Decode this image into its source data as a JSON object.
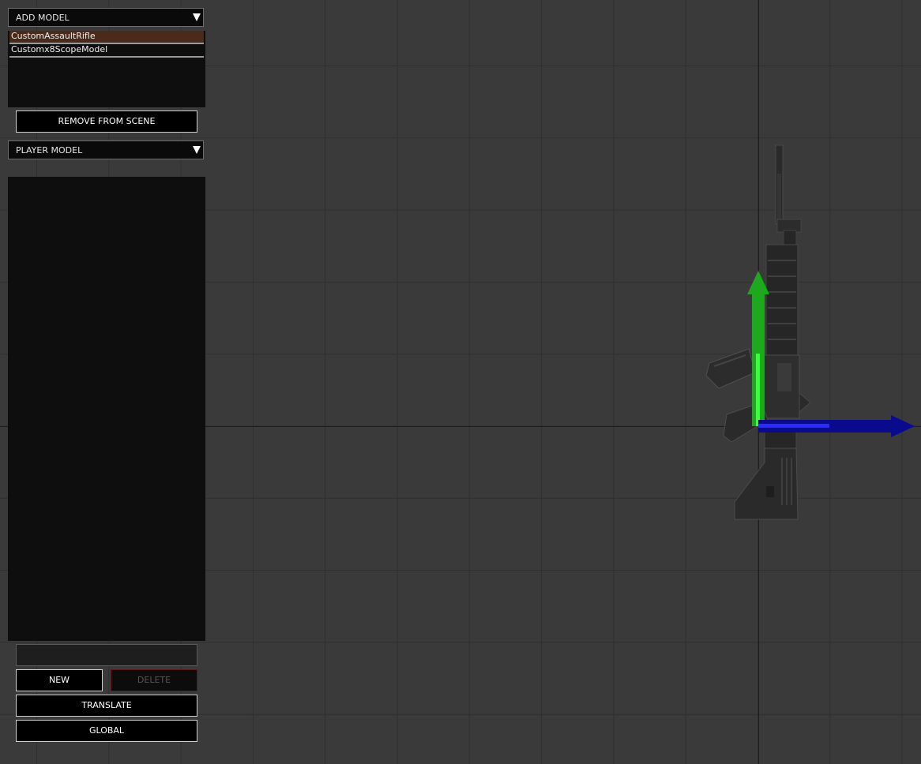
{
  "top_dropdown": {
    "label": "ADD MODEL"
  },
  "model_list": {
    "items": [
      {
        "label": "CustomAssaultRifle",
        "selected": true
      },
      {
        "label": "Customx8ScopeModel",
        "selected": false
      }
    ]
  },
  "remove_button": {
    "label": "REMOVE FROM SCENE"
  },
  "second_dropdown": {
    "label": "PLAYER MODEL"
  },
  "name_input": {
    "value": "",
    "placeholder": ""
  },
  "buttons": {
    "new": "NEW",
    "delete": "DELETE",
    "translate": "TRANSLATE",
    "global": "GLOBAL"
  },
  "colors": {
    "viewport_bg": "#3a3a3a",
    "grid_line": "#2f2f2f",
    "gizmo_y": "#1ea81e",
    "gizmo_y_highlight": "#3cff3c",
    "gizmo_x": "#0a0a8c",
    "gizmo_x_highlight": "#2a2aff",
    "selected_item_bg": "#4a2a1a"
  },
  "icons": {
    "dropdown_arrow": "triangle-down-icon",
    "gizmo_up": "arrow-up-icon",
    "gizmo_right": "arrow-right-icon"
  }
}
